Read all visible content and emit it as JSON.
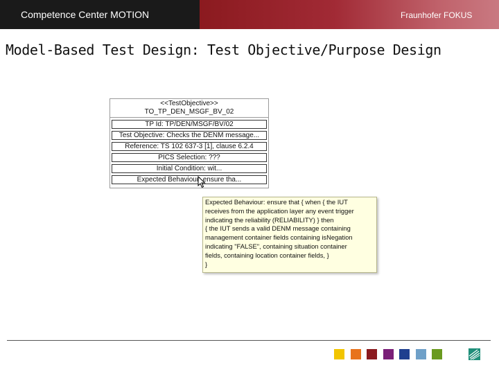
{
  "header": {
    "left_title": "Competence Center MOTION",
    "right_title": "Fraunhofer FOKUS"
  },
  "page_title": "Model-Based Test Design: Test Objective/Purpose Design",
  "test_objective": {
    "stereotype": "<<TestObjective>>",
    "name": "TO_TP_DEN_MSGF_BV_02",
    "fields": [
      "TP Id: TP/DEN/MSGF/BV/02",
      "Test Objective: Checks the DENM message...",
      "Reference: TS 102 637-3 [1], clause 6.2.4",
      "PICS Selection: ???",
      "Initial Condition: wit...",
      "Expected Behaviour: ensure tha..."
    ]
  },
  "tooltip": {
    "lines": [
      "Expected Behaviour: ensure that { when { the IUT",
      "receives from the application layer any event trigger",
      "indicating the reliability (RELIABILITY) } then",
      "{ the IUT sends a valid DENM message containing",
      "management container fields containing isNegation",
      "indicating \"FALSE\", containing situation container",
      "fields, containing location container fields, }",
      "}"
    ]
  },
  "footer": {
    "swatch_colors": [
      "#f2c500",
      "#e8731c",
      "#8b1a1f",
      "#7a1f78",
      "#1f3f8f",
      "#6fa0c8",
      "#6a9a1f"
    ],
    "logo_icon": "fraunhofer-logo-icon",
    "logo_color": "#1f8f7a"
  },
  "cursor_icon": "mouse-pointer-icon"
}
